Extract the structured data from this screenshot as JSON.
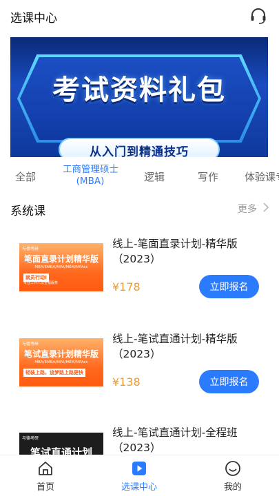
{
  "header": {
    "title": "选课中心",
    "support_icon": "headset-icon"
  },
  "banner": {
    "title": "考试资料礼包",
    "subtitle": "从入门到精通技巧"
  },
  "tabs": [
    {
      "label": "全部"
    },
    {
      "label_line1": "工商管理硕士",
      "label_line2": "(MBA)",
      "active": true
    },
    {
      "label": "逻辑"
    },
    {
      "label": "写作"
    },
    {
      "label": "体验课专"
    }
  ],
  "section": {
    "title": "系统课",
    "more_label": "更多"
  },
  "courses": [
    {
      "name_line1": "线上-笔面直录计划-精华版",
      "name_line2": "（2023）",
      "price": "¥178",
      "enroll_label": "立即报名",
      "thumb": {
        "logo": "与德考研",
        "main": "笔面直录计划精华版",
        "tags": "MBA/EMBA/MPA/MEM/MPAcc",
        "badge": "就员行动!",
        "note": "专业工作人员全程服务"
      }
    },
    {
      "name_line1": "线上-笔试直通计划-精华版",
      "name_line2": "（2023）",
      "price": "¥138",
      "enroll_label": "立即报名",
      "thumb": {
        "logo": "与德考研",
        "main": "笔试直录计划精华版",
        "tags": "MBA/EMBA/MPA/MEM/MPAcc",
        "badge": "轻装上路，追梦路上路更快"
      }
    },
    {
      "name_line1": "线上-笔试直通计划-全程班",
      "name_line2": "（2023）",
      "thumb": {
        "logo": "与德考研",
        "main": "笔试直通计划"
      }
    }
  ],
  "navbar": {
    "items": [
      {
        "label": "首页",
        "icon": "home-icon"
      },
      {
        "label": "选课中心",
        "icon": "play-icon",
        "active": true
      },
      {
        "label": "我的",
        "icon": "profile-icon"
      }
    ]
  },
  "colors": {
    "accent": "#2b7bff",
    "price": "#f59a23"
  }
}
